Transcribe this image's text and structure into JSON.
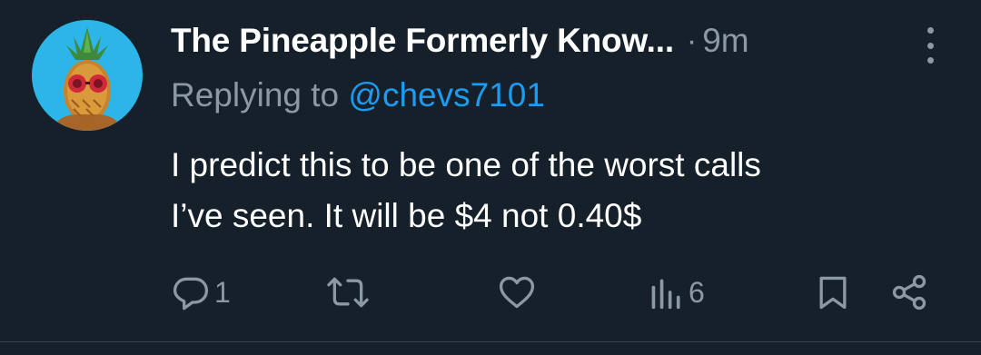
{
  "tweet": {
    "author_name": "The Pineapple Formerly Know...",
    "separator": "·",
    "time": "9m",
    "reply_prefix": "Replying to",
    "reply_handle": "@chevs7101",
    "text_line1": "I predict this to be one of the worst calls",
    "text_line2": "I’ve seen. It will be $4 not 0.40$"
  },
  "actions": {
    "reply_count": "1",
    "retweet_count": "",
    "like_count": "",
    "views_count": "6"
  },
  "icons": {
    "reply": "reply-icon",
    "retweet": "retweet-icon",
    "like": "heart-icon",
    "views": "views-icon",
    "bookmark": "bookmark-icon",
    "share": "share-icon",
    "more": "more-icon"
  },
  "colors": {
    "background": "#15202b",
    "primary_text": "#ffffff",
    "secondary_text": "#8b98a5",
    "link": "#1d9bf0",
    "avatar_bg": "#2bb5e8"
  }
}
